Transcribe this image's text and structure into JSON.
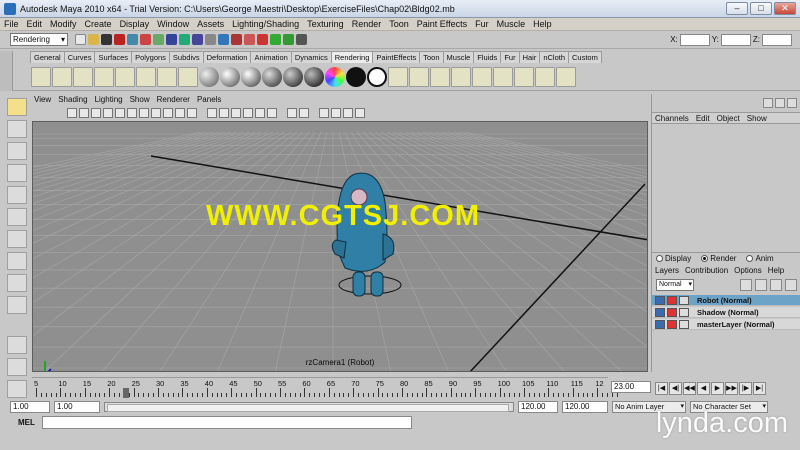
{
  "window": {
    "title": "Autodesk Maya 2010 x64 - Trial Version: C:\\Users\\George Maestri\\Desktop\\ExerciseFiles\\Chap02\\Bldg02.mb"
  },
  "menubar": [
    "File",
    "Edit",
    "Modify",
    "Create",
    "Display",
    "Window",
    "Assets",
    "Lighting/Shading",
    "Texturing",
    "Render",
    "Toon",
    "Paint Effects",
    "Fur",
    "Muscle",
    "Help"
  ],
  "statusline": {
    "mode": "Rendering",
    "x_label": "X:",
    "y_label": "Y:",
    "z_label": "Z:"
  },
  "shelf_tabs": [
    "General",
    "Curves",
    "Surfaces",
    "Polygons",
    "Subdivs",
    "Deformation",
    "Animation",
    "Dynamics",
    "Rendering",
    "PaintEffects",
    "Toon",
    "Muscle",
    "Fluids",
    "Fur",
    "Hair",
    "nCloth",
    "Custom"
  ],
  "shelf_active_tab": "Rendering",
  "viewport": {
    "menu": [
      "View",
      "Shading",
      "Lighting",
      "Show",
      "Renderer",
      "Panels"
    ],
    "camera_label": "rzCamera1 (Robot)"
  },
  "watermark": "WWW.CGTSJ.COM",
  "channel_box": {
    "menu": [
      "Channels",
      "Edit",
      "Object",
      "Show"
    ]
  },
  "layer_editor": {
    "modes": [
      "Display",
      "Render",
      "Anim"
    ],
    "active_mode": "Render",
    "menu": [
      "Layers",
      "Contribution",
      "Options",
      "Help"
    ],
    "blend_mode": "Normal",
    "layers": [
      {
        "name": "Robot (Normal)",
        "selected": true
      },
      {
        "name": "Shadow (Normal)",
        "selected": false
      },
      {
        "name": "masterLayer (Normal)",
        "selected": false
      }
    ]
  },
  "timeline": {
    "tick_labels": [
      "5",
      "10",
      "15",
      "20",
      "25",
      "30",
      "35",
      "40",
      "45",
      "50",
      "55",
      "60",
      "65",
      "70",
      "75",
      "80",
      "85",
      "90",
      "95",
      "100",
      "105",
      "110",
      "115",
      "12"
    ],
    "current_frame_field": "23.00"
  },
  "range": {
    "start": "1.00",
    "playback_start": "1.00",
    "playback_end": "120.00",
    "end": "120.00",
    "anim_layer": "No Anim Layer",
    "character_set": "No Character Set"
  },
  "cmdline": {
    "label": "MEL"
  },
  "branding": "lynda.com",
  "colors": {
    "robot": "#2f7fa6",
    "viewport_bg": "#8f8f8f",
    "grid": "#a8a8a8",
    "watermark": "#f0f000",
    "selected_layer": "#6ea3c8"
  }
}
